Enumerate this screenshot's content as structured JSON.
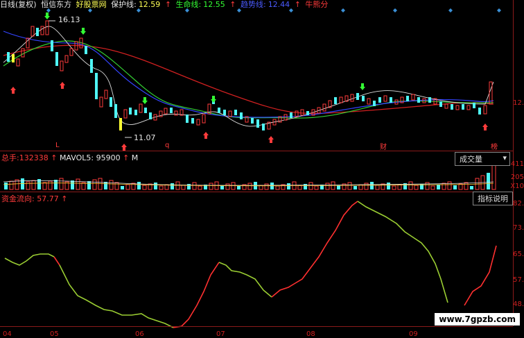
{
  "header": {
    "title": "日线(复权)",
    "stock": "恒信东方",
    "brand": "好股票网",
    "protect_label": "保护线:",
    "protect_val": "12.59",
    "life_label": "生命线:",
    "life_val": "12.55",
    "trend_label": "趋势线:",
    "trend_val": "12.44",
    "bull_label": "牛熊分"
  },
  "price_panel": {
    "high_label": "16.13",
    "low_label": "11.07",
    "right_axis_label": "12.",
    "markers": {
      "L": "L",
      "q": "q",
      "cai": "财",
      "zhuan": "榜"
    }
  },
  "volume_panel": {
    "total_label": "总手:",
    "total_val": "132338",
    "mavol5_label": "MAVOL5:",
    "mavol5_val": "95900",
    "ma_short": "M",
    "dropdown_label": "成交量",
    "axis": [
      "411",
      "205",
      "X10"
    ]
  },
  "flow_panel": {
    "label": "资金流向:",
    "value": "57.77",
    "help_button": "指标说明",
    "axis": [
      "82.",
      "73.",
      "65.",
      "57.",
      "48."
    ]
  },
  "date_axis": [
    "04",
    "05",
    "06",
    "07",
    "08",
    "09"
  ],
  "watermark": "www.7gpzb.com",
  "colors": {
    "up": "#ff3b3b",
    "down": "#4ff6f6",
    "ma_red": "#d02020",
    "ma_green": "#33cc33",
    "ma_blue": "#3344ff",
    "flow_up": "#ff3030",
    "flow_down": "#9acd32"
  }
}
